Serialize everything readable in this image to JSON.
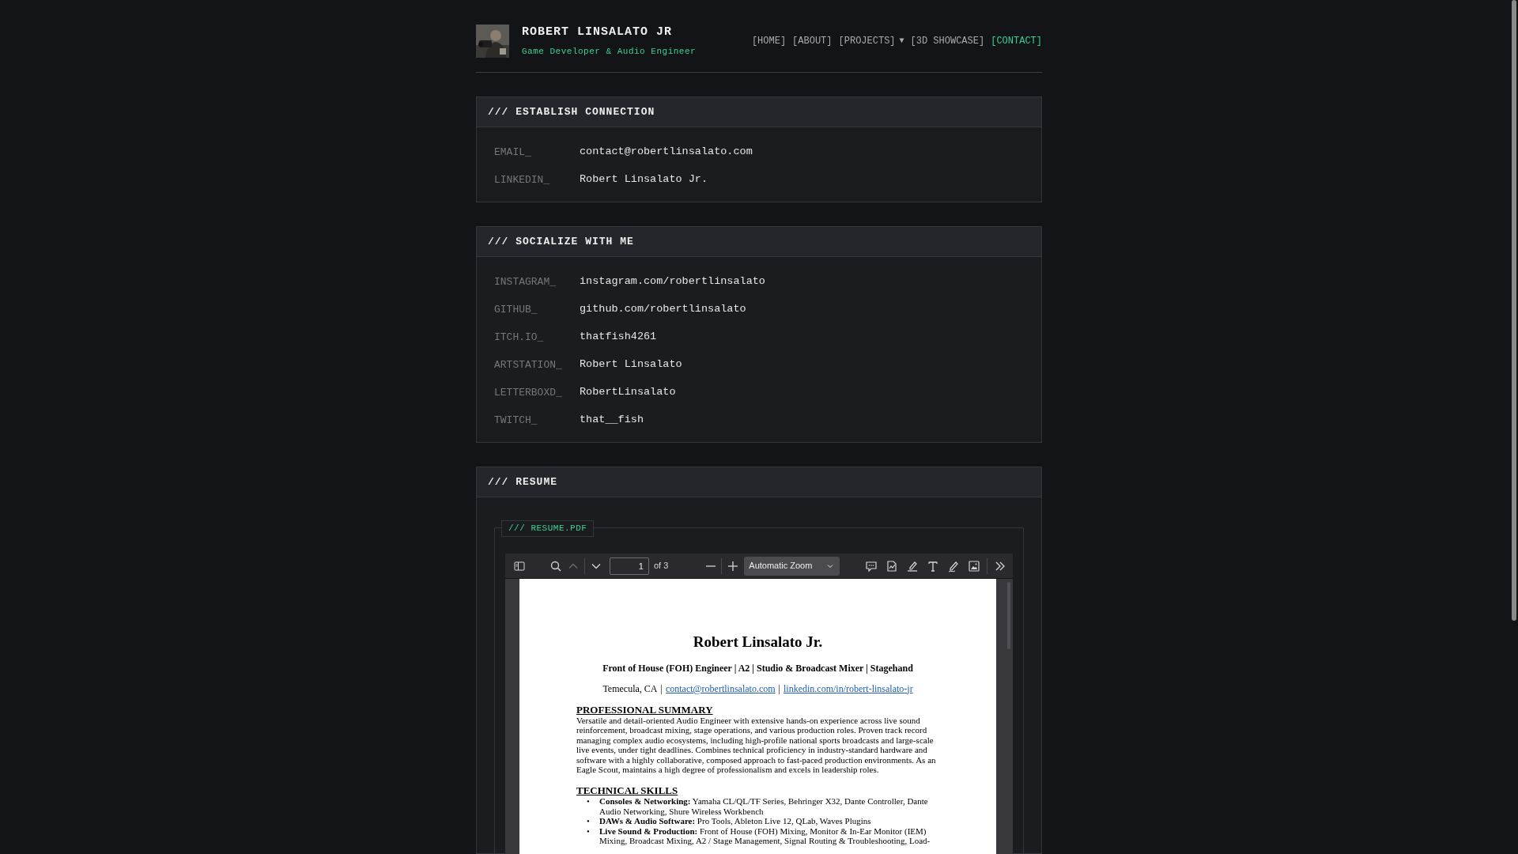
{
  "header": {
    "name": "ROBERT LINSALATO JR",
    "tagline": "Game Developer & Audio Engineer",
    "nav": [
      {
        "label": "[HOME]",
        "selected": false
      },
      {
        "label": "[ABOUT]",
        "selected": false
      },
      {
        "label": "[PROJECTS]",
        "selected": false,
        "caret": "▼"
      },
      {
        "label": "[3D SHOWCASE]",
        "selected": false
      },
      {
        "label": "[CONTACT]",
        "selected": true
      }
    ]
  },
  "sections": [
    {
      "title": "/// ESTABLISH CONNECTION",
      "rows": [
        {
          "label": "EMAIL_",
          "value": "contact@robertlinsalato.com"
        },
        {
          "label": "LINKEDIN_",
          "value": "Robert Linsalato Jr."
        }
      ]
    },
    {
      "title": "/// SOCIALIZE WITH ME",
      "rows": [
        {
          "label": "INSTAGRAM_",
          "value": "instagram.com/robertlinsalato"
        },
        {
          "label": "GITHUB_",
          "value": "github.com/robertlinsalato"
        },
        {
          "label": "ITCH.IO_",
          "value": "thatfish4261"
        },
        {
          "label": "ARTSTATION_",
          "value": "Robert Linsalato"
        },
        {
          "label": "LETTERBOXD_",
          "value": "RobertLinsalato"
        },
        {
          "label": "TWITCH_",
          "value": "that__fish"
        }
      ]
    }
  ],
  "resume": {
    "title": "/// RESUME",
    "legend": "/// RESUME.PDF",
    "viewer": {
      "page": "1",
      "page_count": "of 3",
      "zoom": "Automatic Zoom",
      "previous_disabled": true
    },
    "document": {
      "name": "Robert Linsalato Jr.",
      "subtitle": "Front of House (FOH) Engineer | A2 | Studio & Broadcast Mixer | Stagehand",
      "location": "Temecula, CA",
      "separator": "|",
      "links": [
        "contact@robertlinsalato.com",
        "linkedin.com/in/robert-linsalato-jr"
      ],
      "summary_heading": "PROFESSIONAL SUMMARY",
      "summary": "Versatile and detail-oriented Audio Engineer with extensive hands-on experience across live sound reinforcement, broadcast mixing, stage operations, and various production roles. Proven track record managing complex audio ecosystems, including high-profile national sports broadcasts and large-scale live events, under tight deadlines. Combines technical proficiency in industry-standard hardware and software with a highly collaborative, composed approach to fast-paced production environments. As an Eagle Scout, maintains a high degree of professionalism and excels in leadership roles.",
      "skills_heading": "TECHNICAL SKILLS",
      "bullet": "•",
      "skills": [
        "**Consoles & Networking:** Yamaha CL/QL/TF Series, Behringer X32, Dante Controller, Dante Audio Networking, Shure Wireless Workbench",
        "**DAWs & Audio Software:** Pro Tools, Ableton Live 12, QLab, Waves Plugins",
        "**Live Sound & Production:** Front of House (FOH) Mixing, Monitor & In-Ear Monitor (IEM) Mixing, Broadcast Mixing, A2 / Stage Management, Signal Routing & Troubleshooting, Load-"
      ]
    }
  }
}
